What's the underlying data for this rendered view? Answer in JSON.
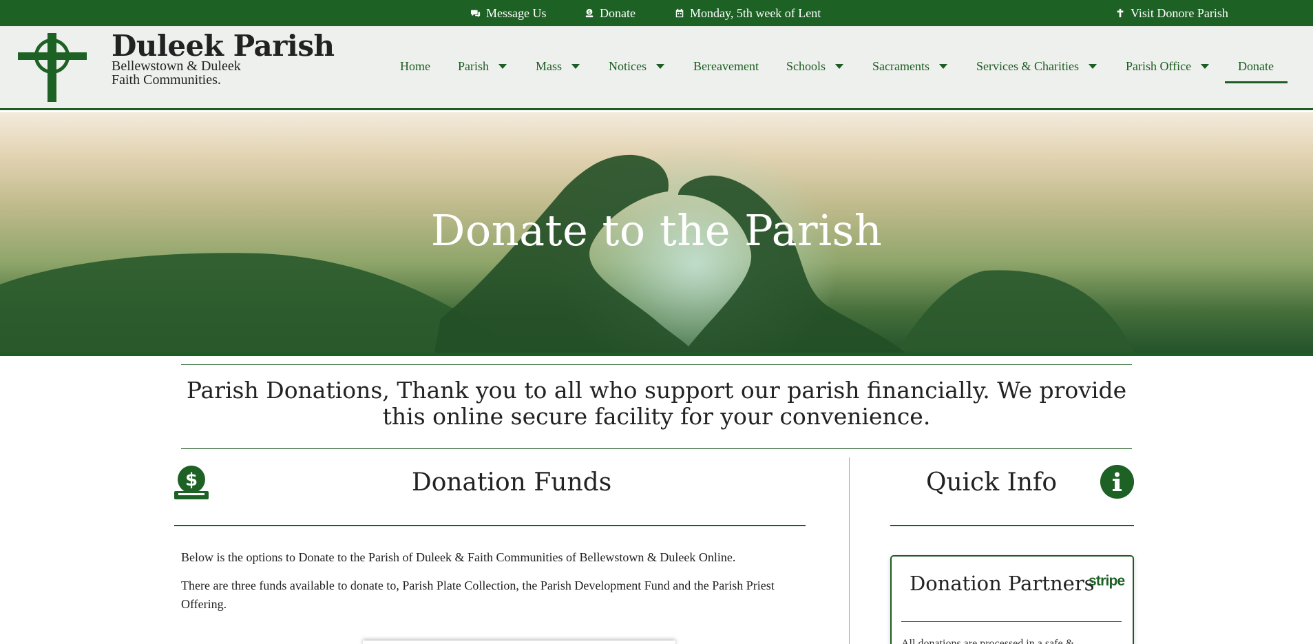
{
  "topbar": {
    "message_label": "Message Us",
    "donate_label": "Donate",
    "date_label": "Monday, 5th week of Lent",
    "visit_label": "Visit Donore Parish"
  },
  "brand": {
    "title": "Duleek Parish",
    "subtitle_line1": "Bellewstown & Duleek",
    "subtitle_line2": "Faith Communities."
  },
  "nav": {
    "items": [
      {
        "label": "Home"
      },
      {
        "label": "Parish"
      },
      {
        "label": "Mass"
      },
      {
        "label": "Notices"
      },
      {
        "label": "Bereavement"
      },
      {
        "label": "Schools"
      },
      {
        "label": "Sacraments"
      },
      {
        "label": "Services & Charities"
      },
      {
        "label": "Parish Office"
      },
      {
        "label": "Donate"
      }
    ],
    "active": "Donate"
  },
  "hero": {
    "title": "Donate to the Parish"
  },
  "intro": {
    "text": "Parish Donations, Thank you to all who support our parish financially. We provide this online secure facility for your convenience."
  },
  "funds": {
    "title": "Donation Funds",
    "para1": "Below is the options to Donate to the Parish of Duleek & Faith Communities of Bellewstown & Duleek Online.",
    "para2": "There are three funds available to donate to, Parish Plate Collection, the Parish Development Fund and the Parish Priest Offering."
  },
  "quick_info": {
    "title": "Quick Info",
    "partners_title": "Donation Partners",
    "partner_logo": "stripe",
    "partners_text": "All donations are processed in a safe &"
  },
  "icons": {
    "message": "chat-icon",
    "donate": "donate-hand-icon",
    "date": "calendar-icon",
    "visit": "cross-icon",
    "fund": "dollar-coin-hand-icon",
    "info": "info-icon"
  },
  "colors": {
    "brand_green": "#1d6125",
    "header_bg": "#edf0ec",
    "divider_gold": "#b9a97a"
  }
}
